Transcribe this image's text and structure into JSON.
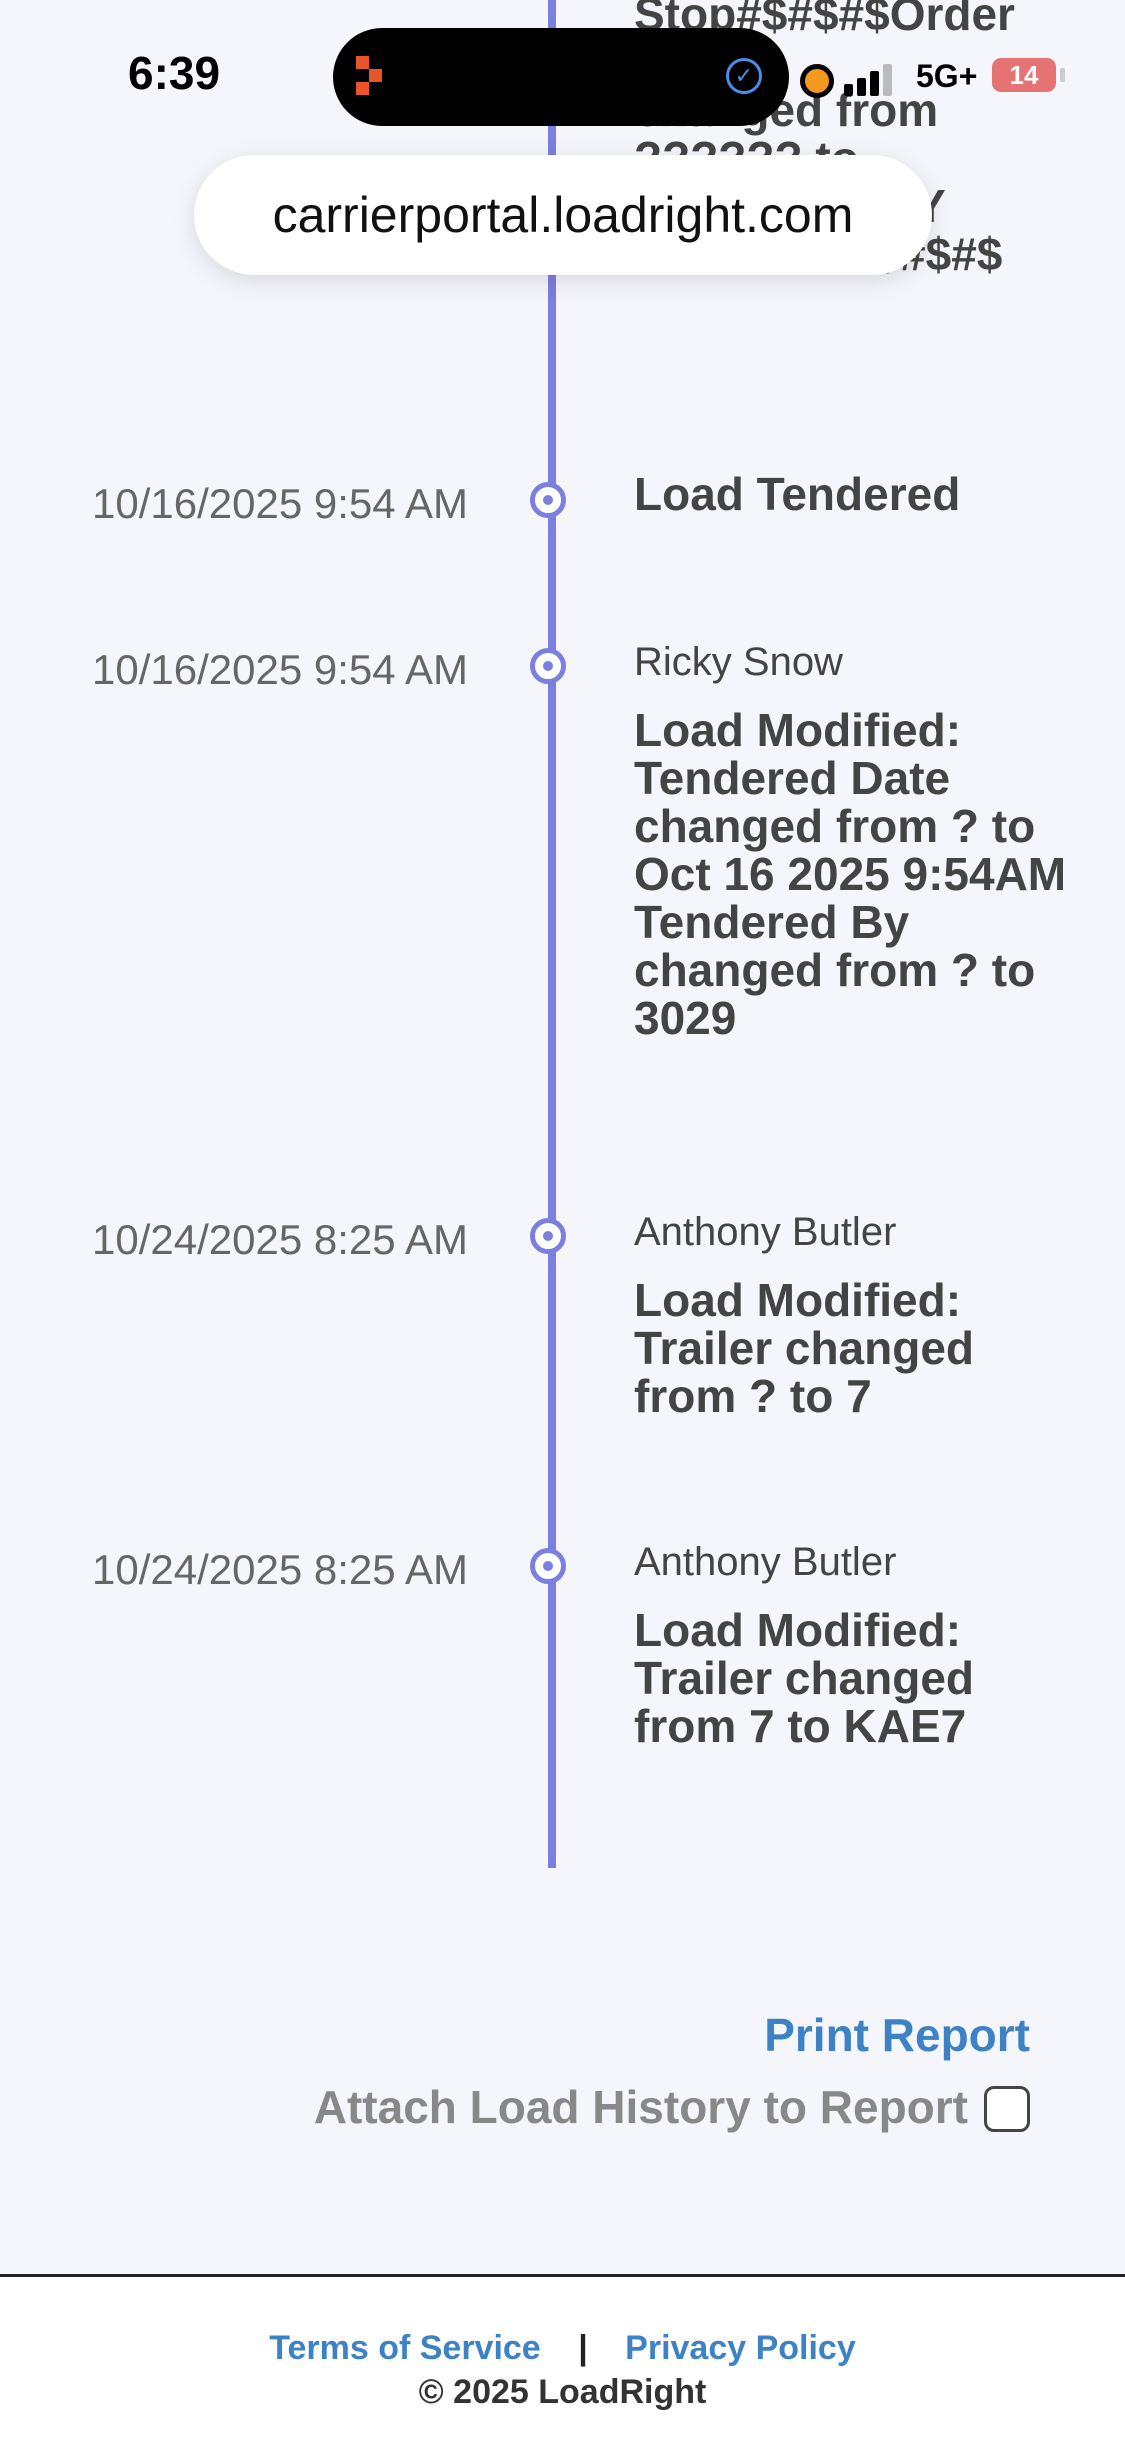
{
  "status_bar": {
    "time": "6:39",
    "network": "5G+",
    "battery": "14"
  },
  "browser": {
    "url": "carrierportal.loadright.com"
  },
  "timeline": {
    "top_partial_text": "Stop#$#$#$Order\nNote\nchanged from\n?????? to\n**DELIVER BY\n10/30/25**#$#$#$",
    "entries": [
      {
        "time": "10/16/2025 9:54 AM",
        "user": "",
        "message": "Load Tendered"
      },
      {
        "time": "10/16/2025 9:54 AM",
        "user": "Ricky Snow",
        "message": "Load Modified: Tendered Date changed from ? to Oct 16 2025 9:54AM Tendered By changed from ? to 3029"
      },
      {
        "time": "10/24/2025 8:25 AM",
        "user": "Anthony Butler",
        "message": "Load Modified: Trailer changed from ? to 7"
      },
      {
        "time": "10/24/2025 8:25 AM",
        "user": "Anthony Butler",
        "message": "Load Modified: Trailer changed from 7 to KAE7"
      }
    ]
  },
  "report": {
    "print_label": "Print Report",
    "attach_label": "Attach Load History to Report",
    "attach_checked": false
  },
  "footer": {
    "terms": "Terms of Service",
    "separator": "|",
    "privacy": "Privacy Policy",
    "copyright": "© 2025 LoadRight"
  }
}
